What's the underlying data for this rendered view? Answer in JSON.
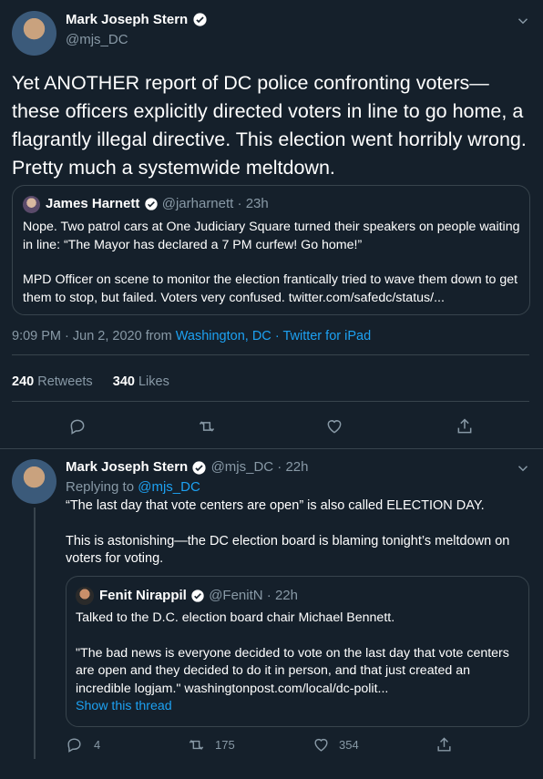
{
  "tweet1": {
    "author_name": "Mark Joseph Stern",
    "handle": "@mjs_DC",
    "text": "Yet ANOTHER report of DC police confronting voters—these officers explicitly directed voters in line to go home, a flagrantly illegal directive. This election went horribly wrong. Pretty much a systemwide meltdown.",
    "quote": {
      "author_name": "James Harnett",
      "handle": "@jarharnett",
      "time": "23h",
      "para1": "Nope. Two patrol cars at One Judiciary Square turned their speakers on people waiting in line: “The Mayor has declared a 7 PM curfew! Go home!”",
      "para2": "MPD Officer on scene to monitor the election frantically tried to wave them down to get them to stop, but failed. Voters very confused. twitter.com/safedc/status/..."
    },
    "timestamp": "9:09 PM · Jun 2, 2020 from",
    "location": "Washington, DC",
    "sep": "·",
    "client": "Twitter for iPad",
    "retweets_count": "240",
    "retweets_label": "Retweets",
    "likes_count": "340",
    "likes_label": "Likes"
  },
  "tweet2": {
    "author_name": "Mark Joseph Stern",
    "handle": "@mjs_DC",
    "time": "22h",
    "replying_to_label": "Replying to",
    "replying_to_handle": "@mjs_DC",
    "para1": "“The last day that vote centers are open” is also called ELECTION DAY.",
    "para2": "This is astonishing—the DC election board is blaming tonight’s meltdown on voters for voting.",
    "quote": {
      "author_name": "Fenit Nirappil",
      "handle": "@FenitN",
      "time": "22h",
      "para1": "Talked to the D.C. election board chair Michael Bennett.",
      "para2": "\"The bad news is everyone decided to vote on the last day that vote centers are open and they decided to do it in person, and that just created an incredible logjam.\" washingtonpost.com/local/dc-polit...",
      "show_thread": "Show this thread"
    },
    "reply_count": "4",
    "retweet_count": "175",
    "like_count": "354"
  },
  "colors": {
    "background": "#15202b",
    "muted": "#8899a6",
    "accent": "#1da1f2",
    "border": "#38444d"
  }
}
